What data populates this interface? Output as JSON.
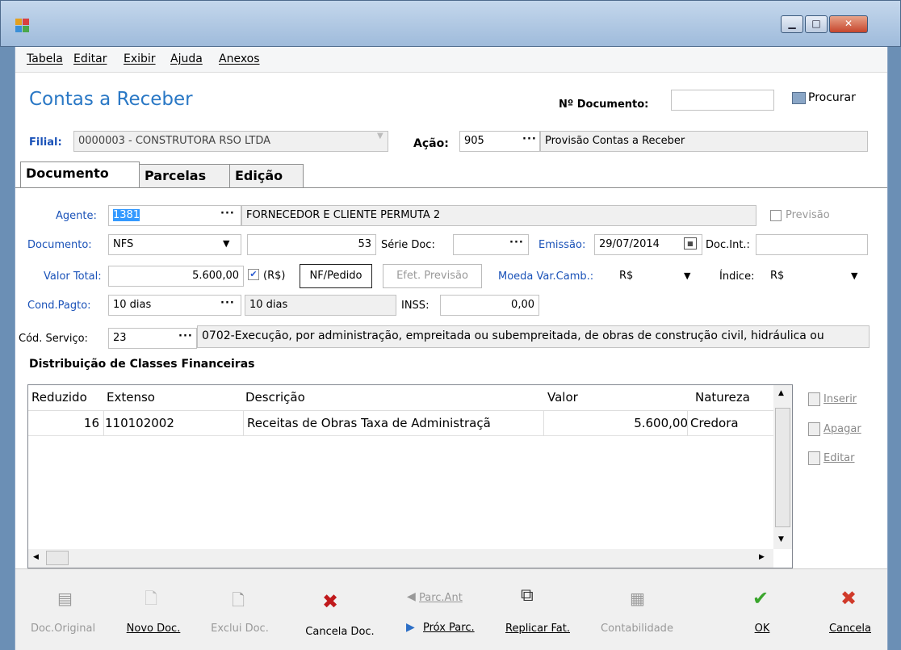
{
  "menu": [
    "Tabela",
    "Editar",
    "Exibir",
    "Ajuda",
    "Anexos"
  ],
  "header": {
    "title": "Contas a Receber",
    "doc_number_label": "Nº Documento:",
    "doc_number_value": "",
    "search_label": "Procurar",
    "filial_label": "Filial:",
    "filial_value": "0000003 - CONSTRUTORA RSO LTDA",
    "acao_label": "Ação:",
    "acao_code": "905",
    "acao_desc": "Provisão Contas a Receber"
  },
  "tabs": [
    "Documento",
    "Parcelas",
    "Edição"
  ],
  "form": {
    "agente_label": "Agente:",
    "agente_code": "1381",
    "agente_name": "FORNECEDOR E CLIENTE PERMUTA 2",
    "previsao_label": "Previsão",
    "documento_label": "Documento:",
    "documento_value": "NFS",
    "documento_number": "53",
    "serie_label": "Série Doc:",
    "serie_value": "",
    "emissao_label": "Emissão:",
    "emissao_value": "29/07/2014",
    "docint_label": "Doc.Int.:",
    "docint_value": "",
    "valor_label": "Valor Total:",
    "valor_value": "5.600,00",
    "rs_label": "(R$)",
    "nfpedido_label": "NF/Pedido",
    "efet_label": "Efet. Previsão",
    "moeda_label": "Moeda Var.Camb.:",
    "moeda_value": "R$",
    "indice_label": "Índice:",
    "indice_value": "R$",
    "cond_label": "Cond.Pagto:",
    "cond_value": "10 dias",
    "cond_desc": "10 dias",
    "inss_label": "INSS:",
    "inss_value": "0,00",
    "cod_label": "Cód. Serviço:",
    "cod_value": "23",
    "cod_desc": "0702-Execução, por administração, empreitada ou subempreitada, de obras de construção civil, hidráulica ou"
  },
  "distrib": {
    "title": "Distribuição de Classes Financeiras",
    "columns": [
      "Reduzido",
      "Extenso",
      "Descrição",
      "Valor",
      "Natureza"
    ],
    "rows": [
      {
        "reduzido": "16",
        "extenso": "110102002",
        "descricao": "Receitas de Obras Taxa de Administraçã",
        "valor": "5.600,00",
        "natureza": "Credora"
      }
    ],
    "buttons": [
      "Inserir",
      "Apagar",
      "Editar"
    ]
  },
  "footer": {
    "doc_original": "Doc.Original",
    "novo_doc": "Novo Doc.",
    "exclui_doc": "Exclui Doc.",
    "cancela_doc": "Cancela Doc.",
    "parc_ant": "Parc.Ant",
    "prox_parc": "Próx Parc.",
    "replicar": "Replicar Fat.",
    "contabilidade": "Contabilidade",
    "ok": "OK",
    "cancela": "Cancela"
  },
  "colors": {
    "accent_blue": "#2a78c5",
    "label_blue": "#1a52b8",
    "ok_green": "#3aa52c",
    "cancel_red": "#d03a2a"
  }
}
